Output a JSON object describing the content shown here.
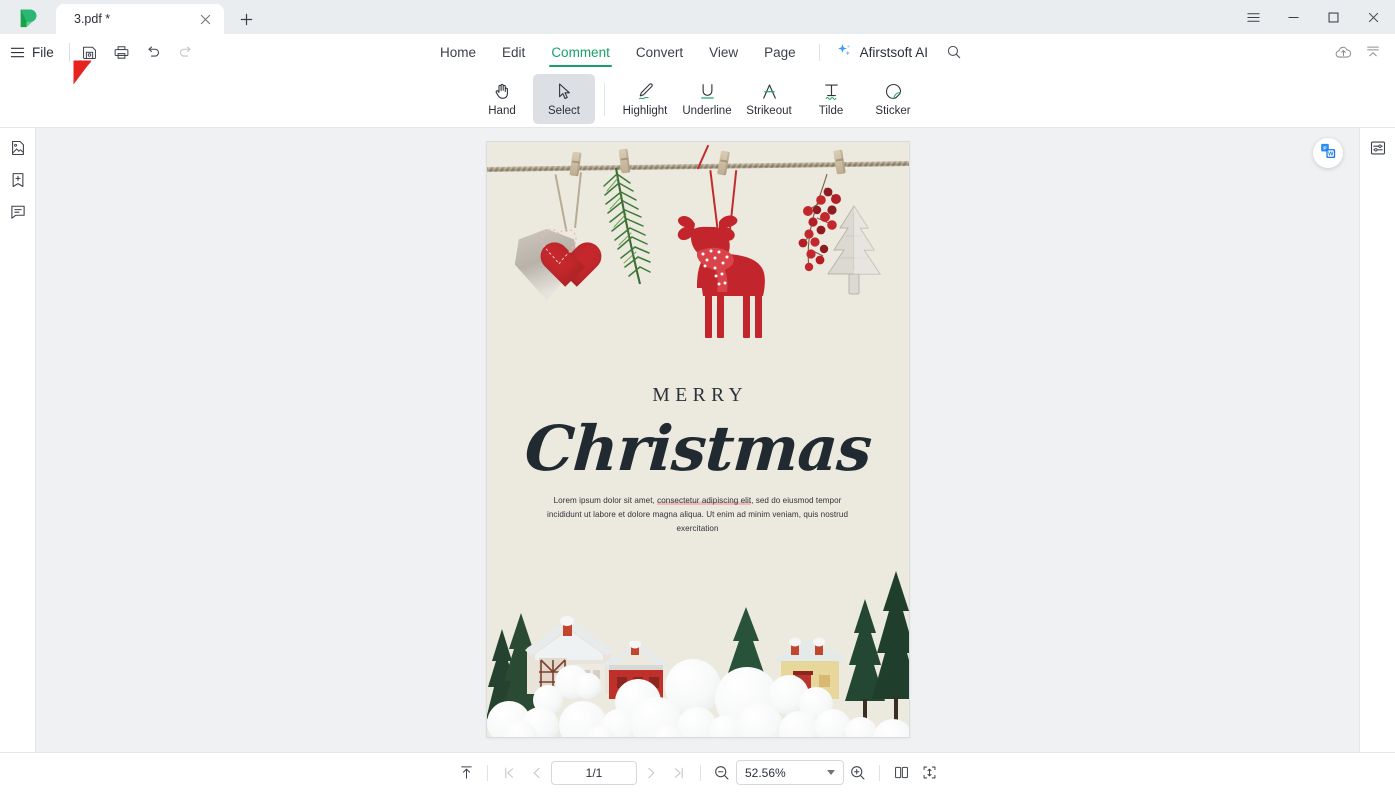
{
  "window": {
    "app_logo": "afirstsoft-logo",
    "tabs": [
      {
        "title": "3.pdf *",
        "modified": true
      }
    ],
    "new_tab_label": "+",
    "controls": {
      "menu": "hamburger-icon",
      "minimize": "minimize-icon",
      "maximize": "maximize-icon",
      "close": "close-icon"
    }
  },
  "menubar": {
    "hamburger": "main-menu-icon",
    "file_label": "File",
    "quick_access": [
      {
        "name": "save",
        "icon": "save-icon",
        "enabled": true
      },
      {
        "name": "print",
        "icon": "print-icon",
        "enabled": true
      },
      {
        "name": "undo",
        "icon": "undo-icon",
        "enabled": true
      },
      {
        "name": "redo",
        "icon": "redo-icon",
        "enabled": false
      }
    ],
    "tabs": [
      {
        "label": "Home",
        "active": false
      },
      {
        "label": "Edit",
        "active": false
      },
      {
        "label": "Comment",
        "active": true
      },
      {
        "label": "Convert",
        "active": false
      },
      {
        "label": "View",
        "active": false
      },
      {
        "label": "Page",
        "active": false
      }
    ],
    "ai_label": "Afirstsoft AI",
    "ai_icon": "sparkle-icon",
    "search_icon": "search-icon",
    "right_actions": [
      {
        "name": "cloud-upload",
        "icon": "cloud-upload-icon"
      },
      {
        "name": "collapse-ribbon",
        "icon": "collapse-ribbon-icon"
      }
    ]
  },
  "ribbon": {
    "items": [
      {
        "label": "Hand",
        "icon": "hand-icon",
        "active": false
      },
      {
        "label": "Select",
        "icon": "cursor-arrow-icon",
        "active": true
      },
      {
        "label": "Highlight",
        "icon": "highlight-pen-icon",
        "active": false
      },
      {
        "label": "Underline",
        "icon": "underline-icon",
        "active": false
      },
      {
        "label": "Strikeout",
        "icon": "strikeout-icon",
        "active": false
      },
      {
        "label": "Tilde",
        "icon": "tilde-icon",
        "active": false
      },
      {
        "label": "Sticker",
        "icon": "sticker-icon",
        "active": false
      }
    ]
  },
  "left_sidebar": {
    "items": [
      {
        "name": "thumbnails",
        "icon": "page-thumbnail-icon"
      },
      {
        "name": "bookmarks",
        "icon": "add-bookmark-icon"
      },
      {
        "name": "comments",
        "icon": "comment-list-icon"
      }
    ]
  },
  "right_sidebar": {
    "items": [
      {
        "name": "properties",
        "icon": "properties-panel-icon"
      }
    ]
  },
  "document": {
    "convert_badge": {
      "name": "pdf-to-word",
      "icon": "pdf-to-word-icon"
    },
    "card": {
      "heading": "MERRY",
      "script_title": "Christmas",
      "body_before": "Lorem ipsum dolor sit amet, ",
      "body_highlighted": "consectetur adipiscing elit",
      "body_after": ", sed do eiusmod tempor incididunt ut labore et dolore magna aliqua. Ut enim ad minim veniam, quis nostrud exercitation",
      "highlight_color": "#e9969e"
    }
  },
  "statusbar": {
    "fit_top_icon": "scroll-to-top-icon",
    "first_page_icon": "first-page-icon",
    "prev_page_icon": "previous-page-icon",
    "page_value": "1/1",
    "page_placeholder": "1/1",
    "next_page_icon": "next-page-icon",
    "last_page_icon": "last-page-icon",
    "zoom_out_icon": "zoom-out-icon",
    "zoom_value": "52.56%",
    "zoom_in_icon": "zoom-in-icon",
    "two_page_icon": "two-page-view-icon",
    "fit_page_icon": "fit-page-icon"
  },
  "annotation": {
    "cursor_arrow": "red-arrow-pointer",
    "color": "#e8221f"
  },
  "colors": {
    "accent_green": "#18a06a",
    "titlebar_bg": "#e9edf0",
    "viewer_bg": "#f0f1f3",
    "card_bg": "#eceadf",
    "card_ink": "#222a31",
    "ornament_red": "#c4282c"
  }
}
